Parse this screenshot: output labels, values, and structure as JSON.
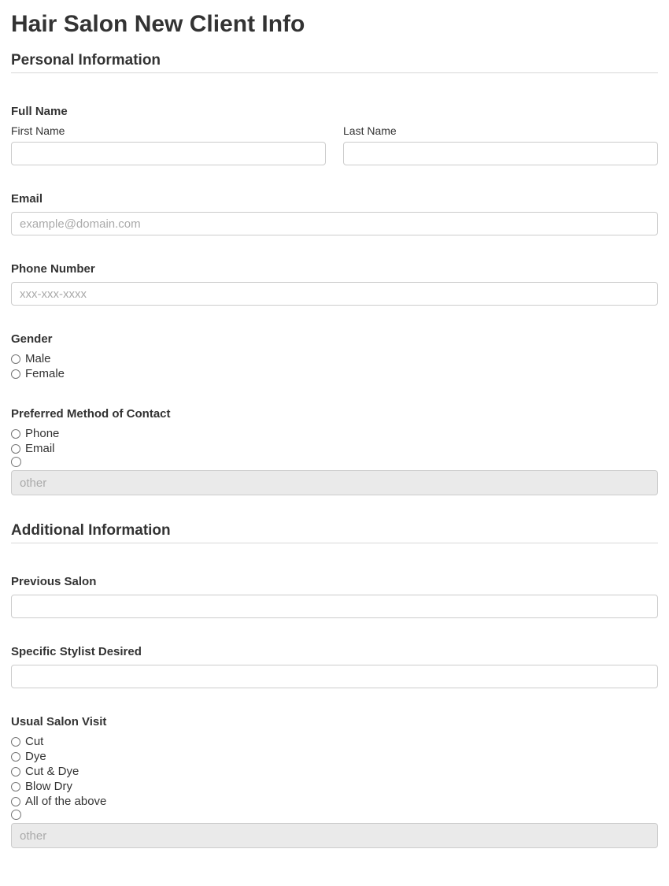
{
  "title": "Hair Salon New Client Info",
  "sections": {
    "personal": {
      "heading": "Personal Information",
      "full_name": {
        "label": "Full Name",
        "first_label": "First Name",
        "last_label": "Last Name"
      },
      "email": {
        "label": "Email",
        "placeholder": "example@domain.com"
      },
      "phone": {
        "label": "Phone Number",
        "placeholder": "xxx-xxx-xxxx"
      },
      "gender": {
        "label": "Gender",
        "options": [
          "Male",
          "Female"
        ]
      },
      "contact_method": {
        "label": "Preferred Method of Contact",
        "options": [
          "Phone",
          "Email"
        ],
        "other_placeholder": "other"
      }
    },
    "additional": {
      "heading": "Additional Information",
      "previous_salon": {
        "label": "Previous Salon"
      },
      "stylist": {
        "label": "Specific Stylist Desired"
      },
      "usual_visit": {
        "label": "Usual Salon Visit",
        "options": [
          "Cut",
          "Dye",
          "Cut & Dye",
          "Blow Dry",
          "All of the above"
        ],
        "other_placeholder": "other"
      }
    }
  }
}
